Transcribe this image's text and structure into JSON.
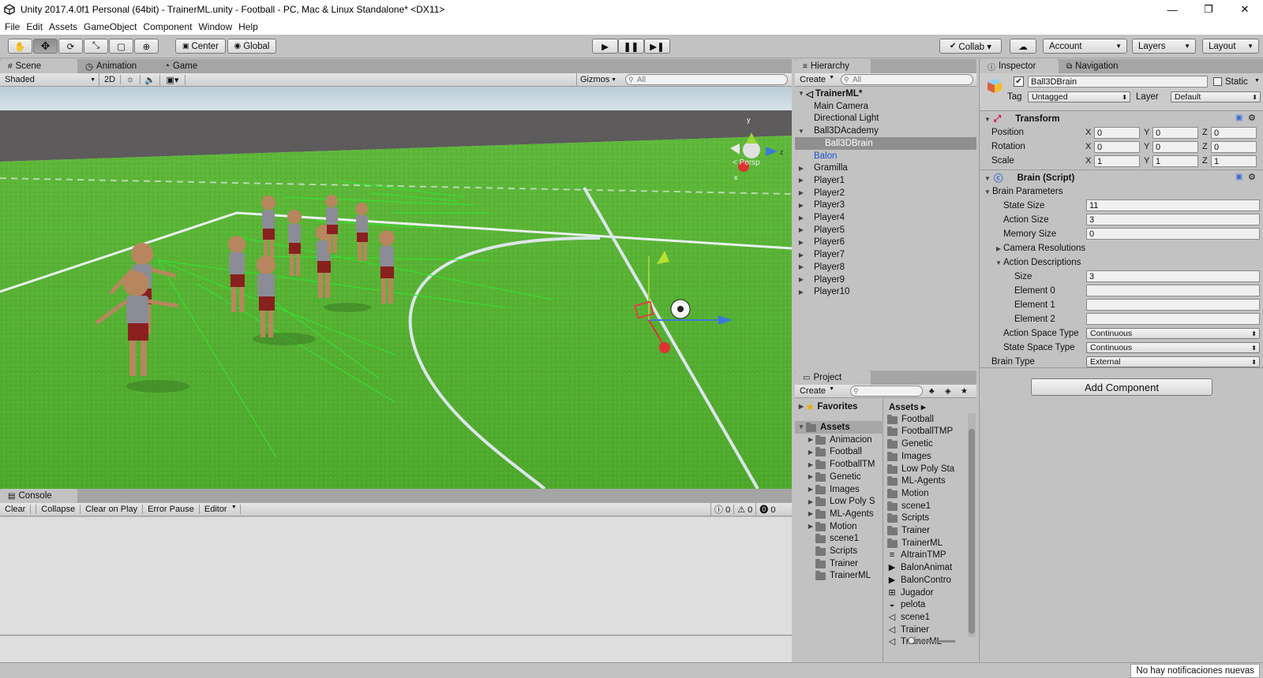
{
  "window": {
    "title": "Unity 2017.4.0f1 Personal (64bit) - TrainerML.unity - Football - PC, Mac & Linux Standalone* <DX11>",
    "minimize": "—",
    "maximize": "❐",
    "close": "✕"
  },
  "menu": [
    "File",
    "Edit",
    "Assets",
    "GameObject",
    "Component",
    "Window",
    "Help"
  ],
  "toolbar": {
    "tools": [
      "hand-icon",
      "move-icon",
      "rotate-icon",
      "scale-icon",
      "rect-icon",
      "transform-icon"
    ],
    "pivot": "Center",
    "space": "Global",
    "collab": "Collab ▾",
    "account": "Account",
    "layers": "Layers",
    "layout": "Layout"
  },
  "scene_panel": {
    "tabs": [
      "Scene",
      "Animation",
      "Game"
    ],
    "shading": "Shaded",
    "mode2d": "2D",
    "gizmos": "Gizmos",
    "search": "All",
    "persp": "< Persp"
  },
  "hierarchy": {
    "tab": "Hierarchy",
    "create": "Create",
    "search": "All",
    "scene": "TrainerML*",
    "items": [
      {
        "label": "Main Camera",
        "indent": 1,
        "arrow": "",
        "selected": false,
        "blue": false
      },
      {
        "label": "Directional Light",
        "indent": 1,
        "arrow": "",
        "selected": false,
        "blue": false
      },
      {
        "label": "Ball3DAcademy",
        "indent": 1,
        "arrow": "▼",
        "selected": false,
        "blue": false
      },
      {
        "label": "Ball3DBrain",
        "indent": 2,
        "arrow": "",
        "selected": true,
        "blue": false
      },
      {
        "label": "Balon",
        "indent": 1,
        "arrow": "",
        "selected": false,
        "blue": true
      },
      {
        "label": "Gramilla",
        "indent": 1,
        "arrow": "▶",
        "selected": false,
        "blue": false
      },
      {
        "label": "Player1",
        "indent": 1,
        "arrow": "▶",
        "selected": false,
        "blue": false
      },
      {
        "label": "Player2",
        "indent": 1,
        "arrow": "▶",
        "selected": false,
        "blue": false
      },
      {
        "label": "Player3",
        "indent": 1,
        "arrow": "▶",
        "selected": false,
        "blue": false
      },
      {
        "label": "Player4",
        "indent": 1,
        "arrow": "▶",
        "selected": false,
        "blue": false
      },
      {
        "label": "Player5",
        "indent": 1,
        "arrow": "▶",
        "selected": false,
        "blue": false
      },
      {
        "label": "Player6",
        "indent": 1,
        "arrow": "▶",
        "selected": false,
        "blue": false
      },
      {
        "label": "Player7",
        "indent": 1,
        "arrow": "▶",
        "selected": false,
        "blue": false
      },
      {
        "label": "Player8",
        "indent": 1,
        "arrow": "▶",
        "selected": false,
        "blue": false
      },
      {
        "label": "Player9",
        "indent": 1,
        "arrow": "▶",
        "selected": false,
        "blue": false
      },
      {
        "label": "Player10",
        "indent": 1,
        "arrow": "▶",
        "selected": false,
        "blue": false
      }
    ]
  },
  "project": {
    "tab": "Project",
    "create": "Create",
    "favorites": "Favorites",
    "assets": "Assets",
    "breadcrumb": "Assets ▸",
    "tree": [
      "Animacion",
      "Football",
      "FootballTM",
      "Genetic",
      "Images",
      "Low Poly S",
      "ML-Agents",
      "Motion",
      "scene1",
      "Scripts",
      "Trainer",
      "TrainerML"
    ],
    "tree_arrows": [
      true,
      true,
      true,
      true,
      true,
      true,
      true,
      true,
      false,
      false,
      false,
      false
    ],
    "files": [
      {
        "name": "Football",
        "icon": "folder"
      },
      {
        "name": "FootballTMP",
        "icon": "folder"
      },
      {
        "name": "Genetic",
        "icon": "folder"
      },
      {
        "name": "Images",
        "icon": "folder"
      },
      {
        "name": "Low Poly Sta",
        "icon": "folder"
      },
      {
        "name": "ML-Agents",
        "icon": "folder"
      },
      {
        "name": "Motion",
        "icon": "folder"
      },
      {
        "name": "scene1",
        "icon": "folder"
      },
      {
        "name": "Scripts",
        "icon": "folder"
      },
      {
        "name": "Trainer",
        "icon": "folder"
      },
      {
        "name": "TrainerML",
        "icon": "folder"
      },
      {
        "name": "AItrainTMP",
        "icon": "text"
      },
      {
        "name": "BalonAnimat",
        "icon": "anim"
      },
      {
        "name": "BalonContro",
        "icon": "anim"
      },
      {
        "name": "Jugador",
        "icon": "controller"
      },
      {
        "name": "pelota",
        "icon": "material"
      },
      {
        "name": "scene1",
        "icon": "unity"
      },
      {
        "name": "Trainer",
        "icon": "unity"
      },
      {
        "name": "TrainerML",
        "icon": "unity"
      }
    ]
  },
  "inspector": {
    "tabs": [
      "Inspector",
      "Navigation"
    ],
    "object_name": "Ball3DBrain",
    "static": "Static",
    "tag_label": "Tag",
    "tag": "Untagged",
    "layer_label": "Layer",
    "layer": "Default",
    "transform": {
      "title": "Transform",
      "rows": [
        {
          "label": "Position",
          "x": "0",
          "y": "0",
          "z": "0"
        },
        {
          "label": "Rotation",
          "x": "0",
          "y": "0",
          "z": "0"
        },
        {
          "label": "Scale",
          "x": "1",
          "y": "1",
          "z": "1"
        }
      ]
    },
    "brain": {
      "title": "Brain (Script)",
      "params": "Brain Parameters",
      "state_size_label": "State Size",
      "state_size": "11",
      "action_size_label": "Action Size",
      "action_size": "3",
      "memory_size_label": "Memory Size",
      "memory_size": "0",
      "camera_res": "Camera Resolutions",
      "action_desc": "Action Descriptions",
      "size_label": "Size",
      "size": "3",
      "elements": [
        "Element 0",
        "Element 1",
        "Element 2"
      ],
      "action_space_label": "Action Space Type",
      "action_space": "Continuous",
      "state_space_label": "State Space Type",
      "state_space": "Continuous",
      "brain_type_label": "Brain Type",
      "brain_type": "External"
    },
    "add_component": "Add Component"
  },
  "console": {
    "tab": "Console",
    "buttons": [
      "Clear",
      "Collapse",
      "Clear on Play",
      "Error Pause",
      "Editor"
    ],
    "counts": [
      "0",
      "0",
      "0"
    ]
  },
  "status": {
    "notifications": "No hay notificaciones nuevas"
  }
}
